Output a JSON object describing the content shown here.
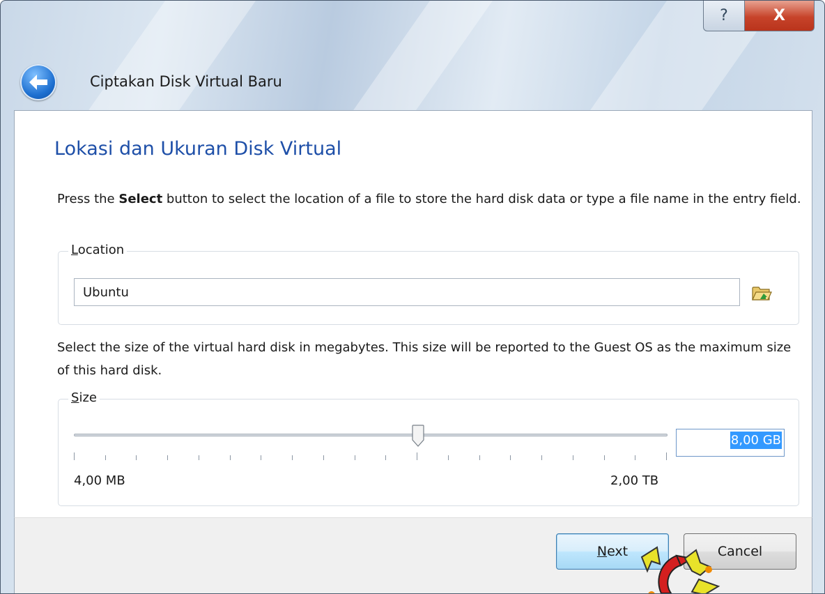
{
  "window": {
    "help_glyph": "?",
    "close_glyph": "X"
  },
  "header": {
    "title": "Ciptakan Disk Virtual Baru"
  },
  "page": {
    "heading": "Lokasi dan Ukuran Disk Virtual",
    "location_desc_prefix": "Press the ",
    "location_desc_bold": "Select",
    "location_desc_suffix": " button to select the location of a file to store the hard disk data or type a file name in the entry field.",
    "size_desc": "Select the size of the virtual hard disk in megabytes. This size will be reported to the Guest OS as the maximum size of this hard disk."
  },
  "location_group": {
    "legend_mnemonic": "L",
    "legend_rest": "ocation",
    "value": "Ubuntu",
    "folder_icon": "folder-open-icon"
  },
  "size_group": {
    "legend_mnemonic": "S",
    "legend_rest": "ize",
    "slider_fraction": 0.58,
    "min_label": "4,00 MB",
    "max_label": "2,00 TB",
    "value": "8,00 GB"
  },
  "footer": {
    "next_mnemonic": "N",
    "next_rest": "ext",
    "cancel_label": "Cancel"
  },
  "colors": {
    "heading": "#1e4fa8",
    "selection": "#3399ff",
    "close_button": "#c7432a"
  }
}
